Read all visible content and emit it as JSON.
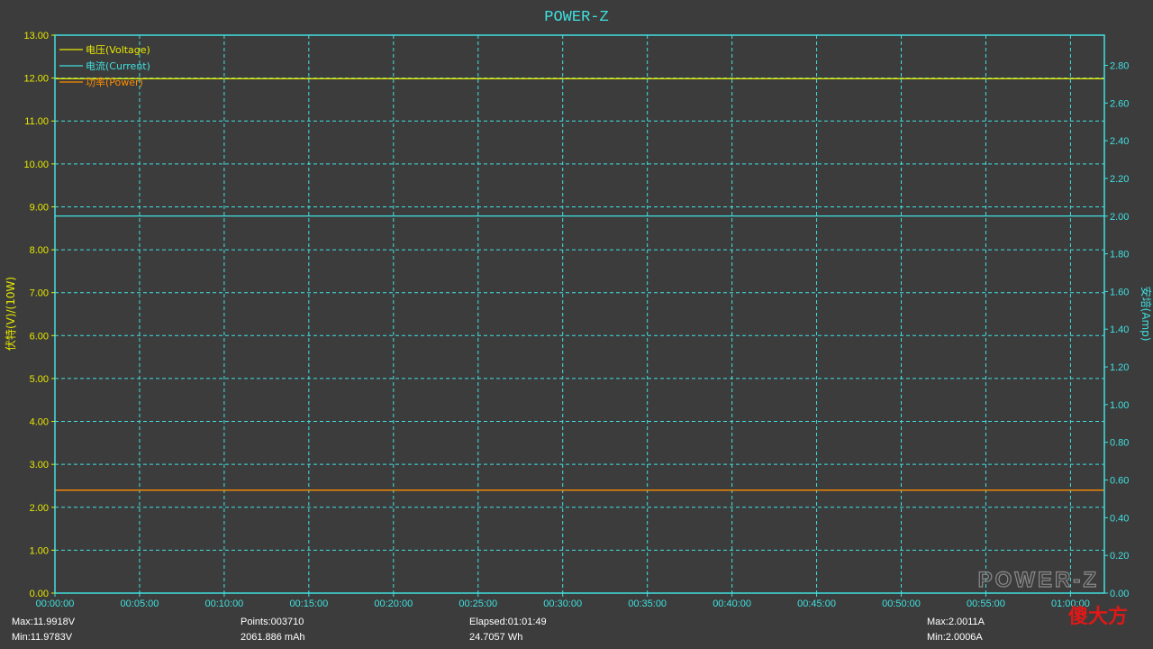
{
  "chart_data": {
    "type": "line",
    "title": "POWER-Z",
    "ylabel_left": "伏特(V)/(10W)",
    "ylabel_right": "安培(Amp)",
    "ylim_left": [
      0,
      13
    ],
    "yticks_left": [
      "0.00",
      "1.00",
      "2.00",
      "3.00",
      "4.00",
      "5.00",
      "6.00",
      "7.00",
      "8.00",
      "9.00",
      "10.00",
      "11.00",
      "12.00",
      "13.00"
    ],
    "ylim_right": [
      0,
      2.96
    ],
    "yticks_right": [
      "0.00",
      "0.20",
      "0.40",
      "0.60",
      "0.80",
      "1.00",
      "1.20",
      "1.40",
      "1.60",
      "1.80",
      "2.00",
      "2.20",
      "2.40",
      "2.60",
      "2.80"
    ],
    "xlim": [
      "00:00:00",
      "01:02:00"
    ],
    "xticks": [
      "00:00:00",
      "00:05:00",
      "00:10:00",
      "00:15:00",
      "00:20:00",
      "00:25:00",
      "00:30:00",
      "00:35:00",
      "00:40:00",
      "00:45:00",
      "00:50:00",
      "00:55:00",
      "01:00:00"
    ],
    "grid": true,
    "legend_position": "top-left",
    "series": [
      {
        "name": "电压(Voltage)",
        "axis": "left",
        "color": "#e8e800",
        "x": [
          "00:00:00",
          "01:02:00"
        ],
        "y": [
          11.985,
          11.985
        ]
      },
      {
        "name": "电流(Current)",
        "axis": "right",
        "color": "#40e0e0",
        "x": [
          "00:00:00",
          "01:02:00"
        ],
        "y": [
          2.0008,
          2.0008
        ]
      },
      {
        "name": "功率(Power)",
        "axis": "left",
        "color": "#ff8c00",
        "x": [
          "00:00:00",
          "01:02:00"
        ],
        "y": [
          2.398,
          2.398
        ]
      }
    ]
  },
  "stats": {
    "voltage_max": "Max:11.9918V",
    "voltage_min": "Min:11.9783V",
    "points": "Points:003710",
    "capacity": "2061.886 mAh",
    "elapsed": "Elapsed:01:01:49",
    "energy": "24.7057 Wh",
    "current_max": "Max:2.0011A",
    "current_min": "Min:2.0006A"
  },
  "watermark_logo": "POWER-Z",
  "watermark_text": "傻大方",
  "colors": {
    "background": "#3c3c3c",
    "axis": "#40e0e0",
    "grid": "#40e0e0",
    "voltage": "#e8e800",
    "current": "#40e0e0",
    "power": "#ff8c00",
    "left_labels": "#e8e800",
    "right_labels": "#40e0e0"
  }
}
